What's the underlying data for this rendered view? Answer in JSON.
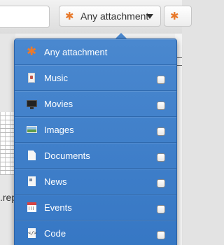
{
  "filter_bar": {
    "attachment_filter": {
      "label": "Any attachment",
      "icon": "asterisk-icon",
      "icon_color": "#e8792b"
    },
    "next_filter_icon": "asterisk-icon"
  },
  "background": {
    "partial_text": ".rep"
  },
  "dropdown": {
    "background_color": "#3d7ec9",
    "items": [
      {
        "label": "Any attachment",
        "icon": "asterisk-icon",
        "has_checkbox": false
      },
      {
        "label": "Music",
        "icon": "music-file-icon",
        "has_checkbox": true,
        "checked": false
      },
      {
        "label": "Movies",
        "icon": "monitor-icon",
        "has_checkbox": true,
        "checked": false
      },
      {
        "label": "Images",
        "icon": "image-icon",
        "has_checkbox": true,
        "checked": false
      },
      {
        "label": "Documents",
        "icon": "document-icon",
        "has_checkbox": true,
        "checked": false
      },
      {
        "label": "News",
        "icon": "newspaper-icon",
        "has_checkbox": true,
        "checked": false
      },
      {
        "label": "Events",
        "icon": "calendar-icon",
        "has_checkbox": true,
        "checked": false
      },
      {
        "label": "Code",
        "icon": "code-file-icon",
        "has_checkbox": true,
        "checked": false
      }
    ]
  }
}
